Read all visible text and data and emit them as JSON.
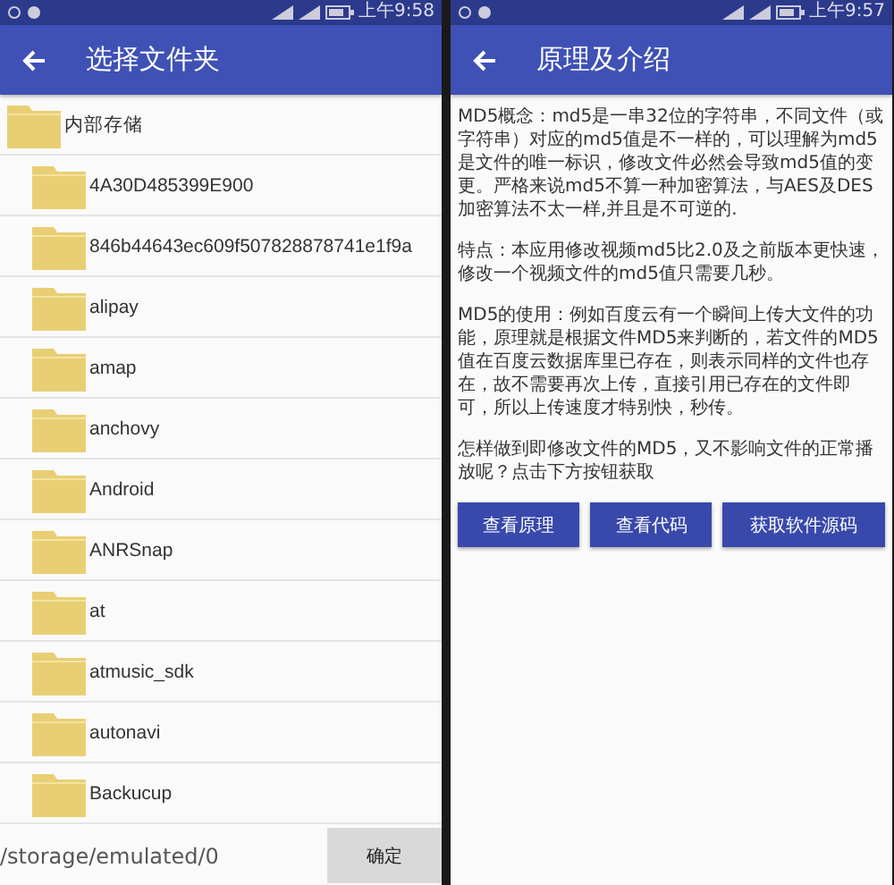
{
  "screens": [
    {
      "kind": "folder_picker",
      "status_bar": {
        "time": "上午9:58"
      },
      "app_bar": {
        "title": "选择文件夹"
      },
      "tree": [
        {
          "name": "内部存储",
          "children": [
            {
              "name": "4A30D485399E900"
            },
            {
              "name": "846b44643ec609f507828878741e1f9a"
            },
            {
              "name": "alipay"
            },
            {
              "name": "amap"
            },
            {
              "name": "anchovy"
            },
            {
              "name": "Android"
            },
            {
              "name": "ANRSnap"
            },
            {
              "name": "at"
            },
            {
              "name": "atmusic_sdk"
            },
            {
              "name": "autonavi"
            },
            {
              "name": "Backucup"
            }
          ]
        }
      ],
      "path": "/storage/emulated/0",
      "confirm_button": "确定"
    },
    {
      "kind": "article",
      "status_bar": {
        "time": "上午9:57"
      },
      "app_bar": {
        "title": "原理及介绍"
      },
      "paragraphs": [
        "MD5概念：md5是一串32位的字符串，不同文件（或字符串）对应的md5值是不一样的，可以理解为md5是文件的唯一标识，修改文件必然会导致md5值的变更。严格来说md5不算一种加密算法，与AES及DES加密算法不太一样,并且是不可逆的.",
        "特点：本应用修改视频md5比2.0及之前版本更快速，修改一个视频文件的md5值只需要几秒。",
        "MD5的使用：例如百度云有一个瞬间上传大文件的功能，原理就是根据文件MD5来判断的，若文件的MD5值在百度云数据库里已存在，则表示同样的文件也存在，故不需要再次上传，直接引用已存在的文件即可，所以上传速度才特别快，秒传。",
        "怎样做到即修改文件的MD5，又不影响文件的正常播放呢？点击下方按钮获取"
      ],
      "buttons": [
        "查看原理",
        "查看代码",
        "获取软件源码"
      ]
    }
  ]
}
